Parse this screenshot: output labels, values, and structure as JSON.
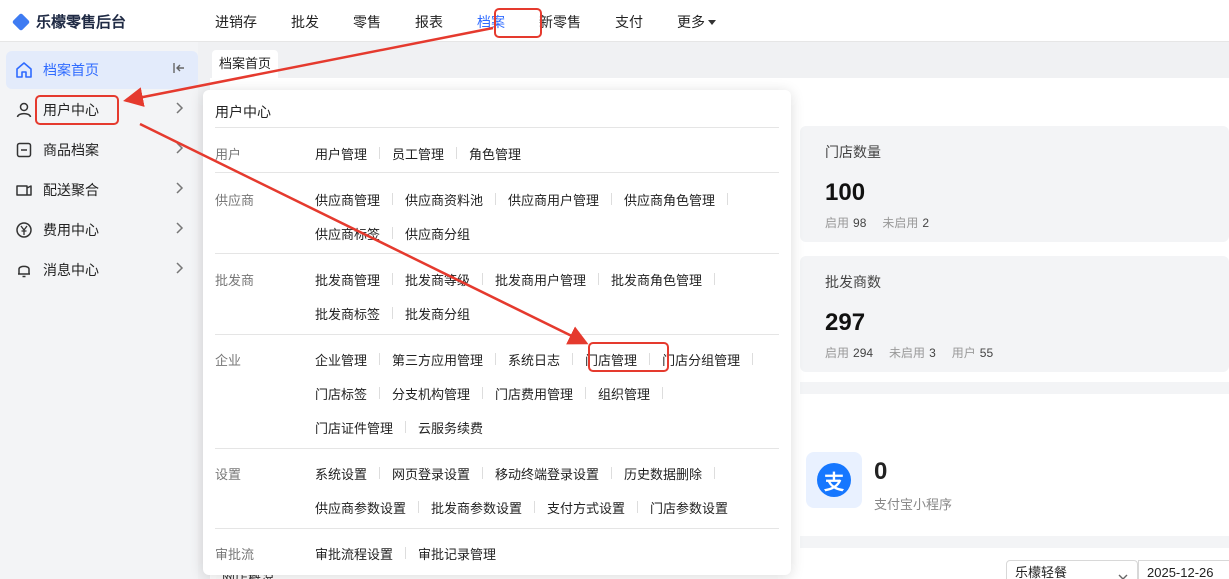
{
  "app": {
    "title": "乐檬零售后台"
  },
  "topnav": [
    {
      "label": "进销存"
    },
    {
      "label": "批发"
    },
    {
      "label": "零售"
    },
    {
      "label": "报表"
    },
    {
      "label": "档案",
      "active": true
    },
    {
      "label": "新零售"
    },
    {
      "label": "支付"
    },
    {
      "label": "更多"
    }
  ],
  "sidebar": {
    "items": [
      {
        "label": "档案首页",
        "icon": "home-icon"
      },
      {
        "label": "用户中心",
        "icon": "user-icon"
      },
      {
        "label": "商品档案",
        "icon": "goods-icon"
      },
      {
        "label": "配送聚合",
        "icon": "delivery-icon"
      },
      {
        "label": "费用中心",
        "icon": "yen-icon"
      },
      {
        "label": "消息中心",
        "icon": "bell-icon"
      }
    ]
  },
  "tabs": [
    {
      "label": "档案首页"
    }
  ],
  "panel": {
    "title": "用户中心",
    "groups": [
      {
        "label": "用户",
        "rows": [
          [
            "用户管理",
            "员工管理",
            "角色管理"
          ]
        ]
      },
      {
        "label": "供应商",
        "rows": [
          [
            "供应商管理",
            "供应商资料池",
            "供应商用户管理",
            "供应商角色管理"
          ],
          [
            "供应商标签",
            "供应商分组"
          ]
        ]
      },
      {
        "label": "批发商",
        "rows": [
          [
            "批发商管理",
            "批发商等级",
            "批发商用户管理",
            "批发商角色管理"
          ],
          [
            "批发商标签",
            "批发商分组"
          ]
        ]
      },
      {
        "label": "企业",
        "rows": [
          [
            "企业管理",
            "第三方应用管理",
            "系统日志",
            "门店管理",
            "门店分组管理"
          ],
          [
            "门店标签",
            "分支机构管理",
            "门店费用管理",
            "组织管理"
          ],
          [
            "门店证件管理",
            "云服务续费"
          ]
        ]
      },
      {
        "label": "设置",
        "rows": [
          [
            "系统设置",
            "网页登录设置",
            "移动终端登录设置",
            "历史数据删除"
          ],
          [
            "供应商参数设置",
            "批发商参数设置",
            "支付方式设置",
            "门店参数设置"
          ]
        ]
      },
      {
        "label": "审批流",
        "rows": [
          [
            "审批流程设置",
            "审批记录管理"
          ]
        ]
      }
    ]
  },
  "stats": {
    "store": {
      "title": "门店数量",
      "value": "100",
      "enabled_label": "启用",
      "enabled": "98",
      "disabled_label": "未启用",
      "disabled": "2"
    },
    "wholesaler": {
      "title": "批发商数",
      "value": "297",
      "enabled_label": "启用",
      "enabled": "294",
      "disabled_label": "未启用",
      "disabled": "3",
      "user_label": "用户",
      "users": "55"
    }
  },
  "apps": {
    "alipay_count": "0",
    "alipay_name": "支付宝小程序",
    "alipay_glyph": "支"
  },
  "bottom": {
    "select_value": "乐檬轻餐",
    "date": "2025-12-26",
    "cut_text": "网店概况"
  },
  "colors": {
    "accent": "#2f6bff",
    "highlight": "#e53a2e",
    "alipay": "#1677ff"
  }
}
